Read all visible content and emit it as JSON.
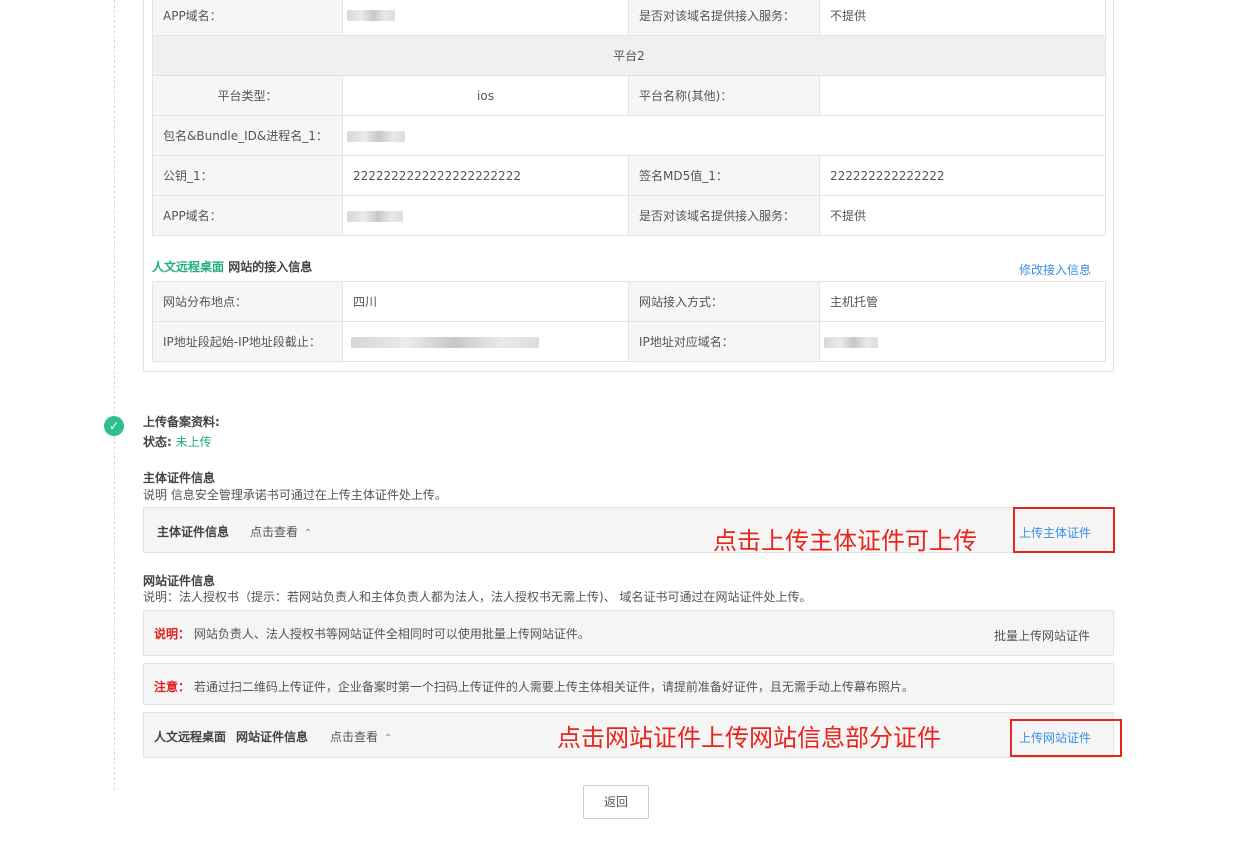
{
  "platform1": {
    "app_domain_label": "APP域名：",
    "provide_service_label": "是否对该域名提供接入服务：",
    "provide_service_value": "不提供"
  },
  "platform2": {
    "header": "平台2",
    "type_label": "平台类型：",
    "type_value": "ios",
    "name_other_label": "平台名称(其他)：",
    "name_other_value": "",
    "bundle_label": "包名&Bundle_ID&进程名_1：",
    "pubkey_label": "公钥_1：",
    "pubkey_value": "2222222222222222222222",
    "md5_label": "签名MD5值_1：",
    "md5_value": "222222222222222",
    "app_domain_label": "APP域名：",
    "provide_service_label": "是否对该域名提供接入服务：",
    "provide_service_value": "不提供"
  },
  "access": {
    "site_name": "人文远程桌面",
    "title": "网站的接入信息",
    "edit_link": "修改接入信息",
    "location_label": "网站分布地点：",
    "location_value": "四川",
    "method_label": "网站接入方式：",
    "method_value": "主机托管",
    "ip_range_label": "IP地址段起始-IP地址段截止：",
    "ip_domain_label": "IP地址对应域名："
  },
  "upload": {
    "title": "上传备案资料:",
    "status_label": "状态:",
    "status_value": "未上传",
    "subject_cert_title": "主体证件信息",
    "subject_cert_desc": "说明 信息安全管理承诺书可通过在上传主体证件处上传。",
    "subject_bar_label": "主体证件信息",
    "subject_view_link": "点击查看",
    "subject_upload_link": "上传主体证件",
    "subject_annotation": "点击上传主体证件可上传",
    "site_cert_title": "网站证件信息",
    "site_cert_desc": "说明：法人授权书（提示：若网站负责人和主体负责人都为法人，法人授权书无需上传)、 域名证书可通过在网站证件处上传。",
    "note1_label": "说明：",
    "note1_text": "网站负责人、法人授权书等网站证件全相同时可以使用批量上传网站证件。",
    "batch_upload_link": "批量上传网站证件",
    "note2_label": "注意：",
    "note2_text": "若通过扫二维码上传证件，企业备案时第一个扫码上传证件的人需要上传主体相关证件，请提前准备好证件，且无需手动上传幕布照片。",
    "site_bar_name": "人文远程桌面",
    "site_bar_label": "网站证件信息",
    "site_view_link": "点击查看",
    "site_upload_link": "上传网站证件",
    "site_annotation": "点击网站证件上传网站信息部分证件"
  },
  "return_button": "返回",
  "colors": {
    "accent_green": "#22b07a",
    "link_blue": "#3a8ee6",
    "annotation_red": "#e8241c"
  }
}
